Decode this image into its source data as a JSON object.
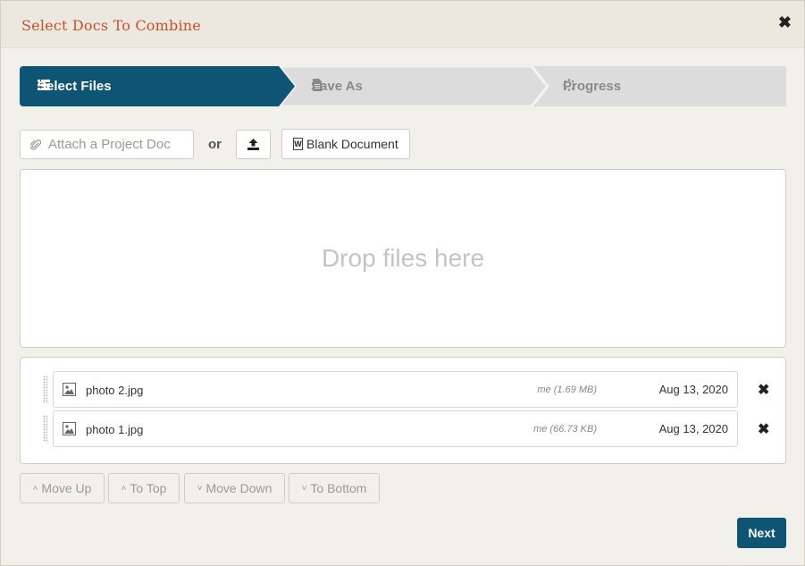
{
  "dialog": {
    "title": "Select Docs To Combine",
    "close_symbol": "✖"
  },
  "wizard": {
    "steps": [
      {
        "label": "Select Files",
        "icon": "list-icon",
        "active": true
      },
      {
        "label": "Save As",
        "icon": "document-icon",
        "active": false
      },
      {
        "label": "Progress",
        "icon": "spinner-icon",
        "active": false
      }
    ],
    "active_color": "#0e5574",
    "inactive_color": "#dcdcdc"
  },
  "toolbar": {
    "attach_placeholder": "Attach a Project Doc",
    "or_label": "or",
    "upload_icon": "upload-icon",
    "blank_document_label": "Blank Document"
  },
  "drop_zone": {
    "text": "Drop files here"
  },
  "files": [
    {
      "name": "photo 2.jpg",
      "owner": "me (1.69 MB)",
      "date": "Aug 13, 2020",
      "icon": "image-icon"
    },
    {
      "name": "photo 1.jpg",
      "owner": "me (66.73 KB)",
      "date": "Aug 13, 2020",
      "icon": "image-icon"
    }
  ],
  "move_buttons": {
    "move_up": "Move Up",
    "to_top": "To Top",
    "move_down": "Move Down",
    "to_bottom": "To Bottom"
  },
  "next_label": "Next",
  "colors": {
    "title": "#c8512a",
    "primary": "#0e5574"
  }
}
